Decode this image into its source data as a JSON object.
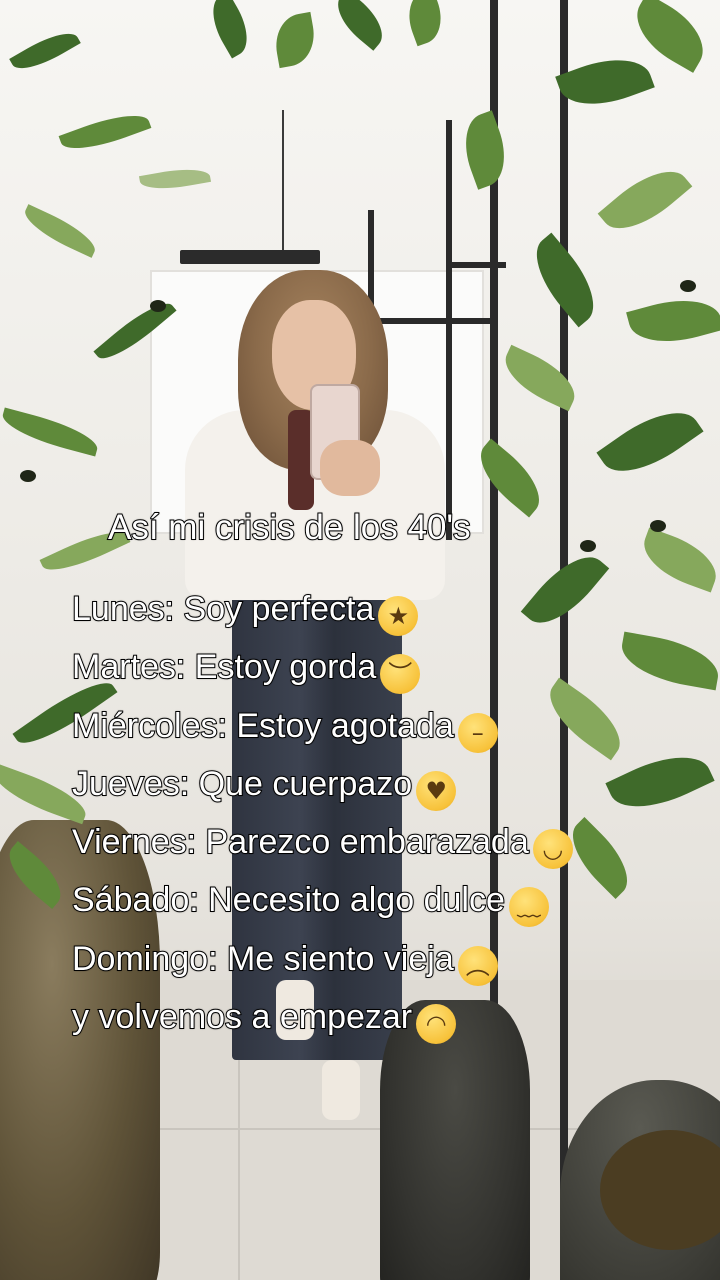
{
  "caption": {
    "title": "Así mi crisis de los 40's",
    "lines": [
      {
        "text": "Lunes: Soy perfecta",
        "emoji": "★"
      },
      {
        "text": "Martes: Estoy gorda",
        "emoji": "︶"
      },
      {
        "text": "Miércoles: Estoy agotada",
        "emoji": "–"
      },
      {
        "text": "Jueves: Que cuerpazo",
        "emoji": "♥"
      },
      {
        "text": "Viernes: Parezco embarazada",
        "emoji": "◡"
      },
      {
        "text": "Sábado: Necesito algo dulce",
        "emoji": "﹏"
      },
      {
        "text": "Domingo: Me siento vieja",
        "emoji": "︵"
      },
      {
        "text": "y volvemos a empezar",
        "emoji": "◠"
      }
    ]
  },
  "emoji_names": [
    "star-struck-emoji",
    "unamused-face-emoji",
    "face-exhaling-emoji",
    "heart-eyes-emoji",
    "melting-face-emoji",
    "drooling-face-emoji",
    "worried-face-emoji",
    "upside-down-face-emoji"
  ]
}
